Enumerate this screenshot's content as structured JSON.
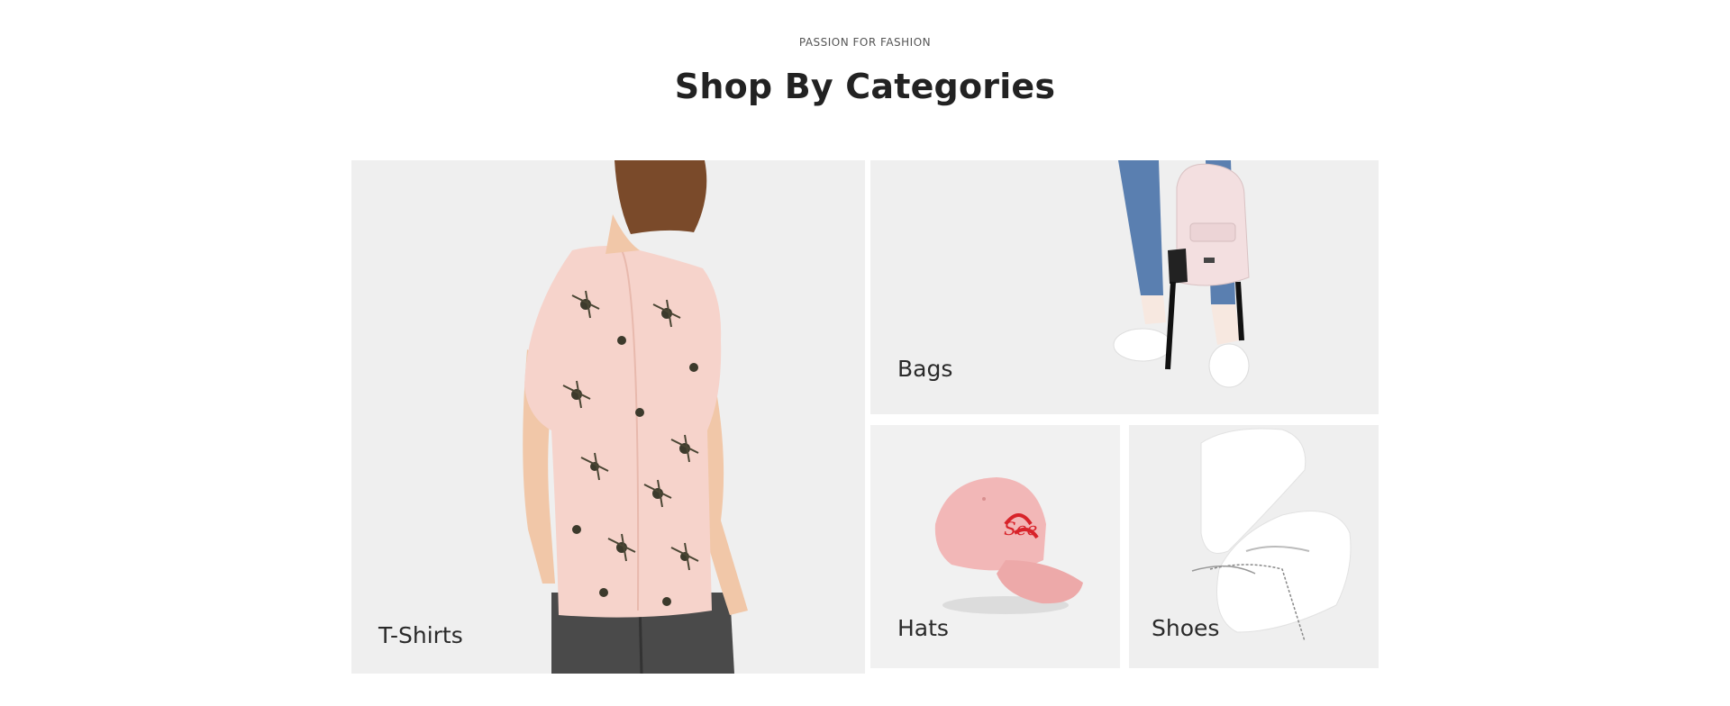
{
  "section": {
    "eyebrow": "PASSION FOR FASHION",
    "title": "Shop By Categories"
  },
  "categories": [
    {
      "label": "T-Shirts",
      "image": "floral-shirt-image"
    },
    {
      "label": "Bags",
      "image": "backpack-image"
    },
    {
      "label": "Hats",
      "image": "pink-cap-image"
    },
    {
      "label": "Shoes",
      "image": "white-sneakers-image"
    }
  ],
  "colors": {
    "tile_background": "#efefef",
    "shirt_pink": "#f6d3cb",
    "cap_pink": "#f2b7b7",
    "cap_embroidery": "#d8232a",
    "text": "#222222"
  }
}
